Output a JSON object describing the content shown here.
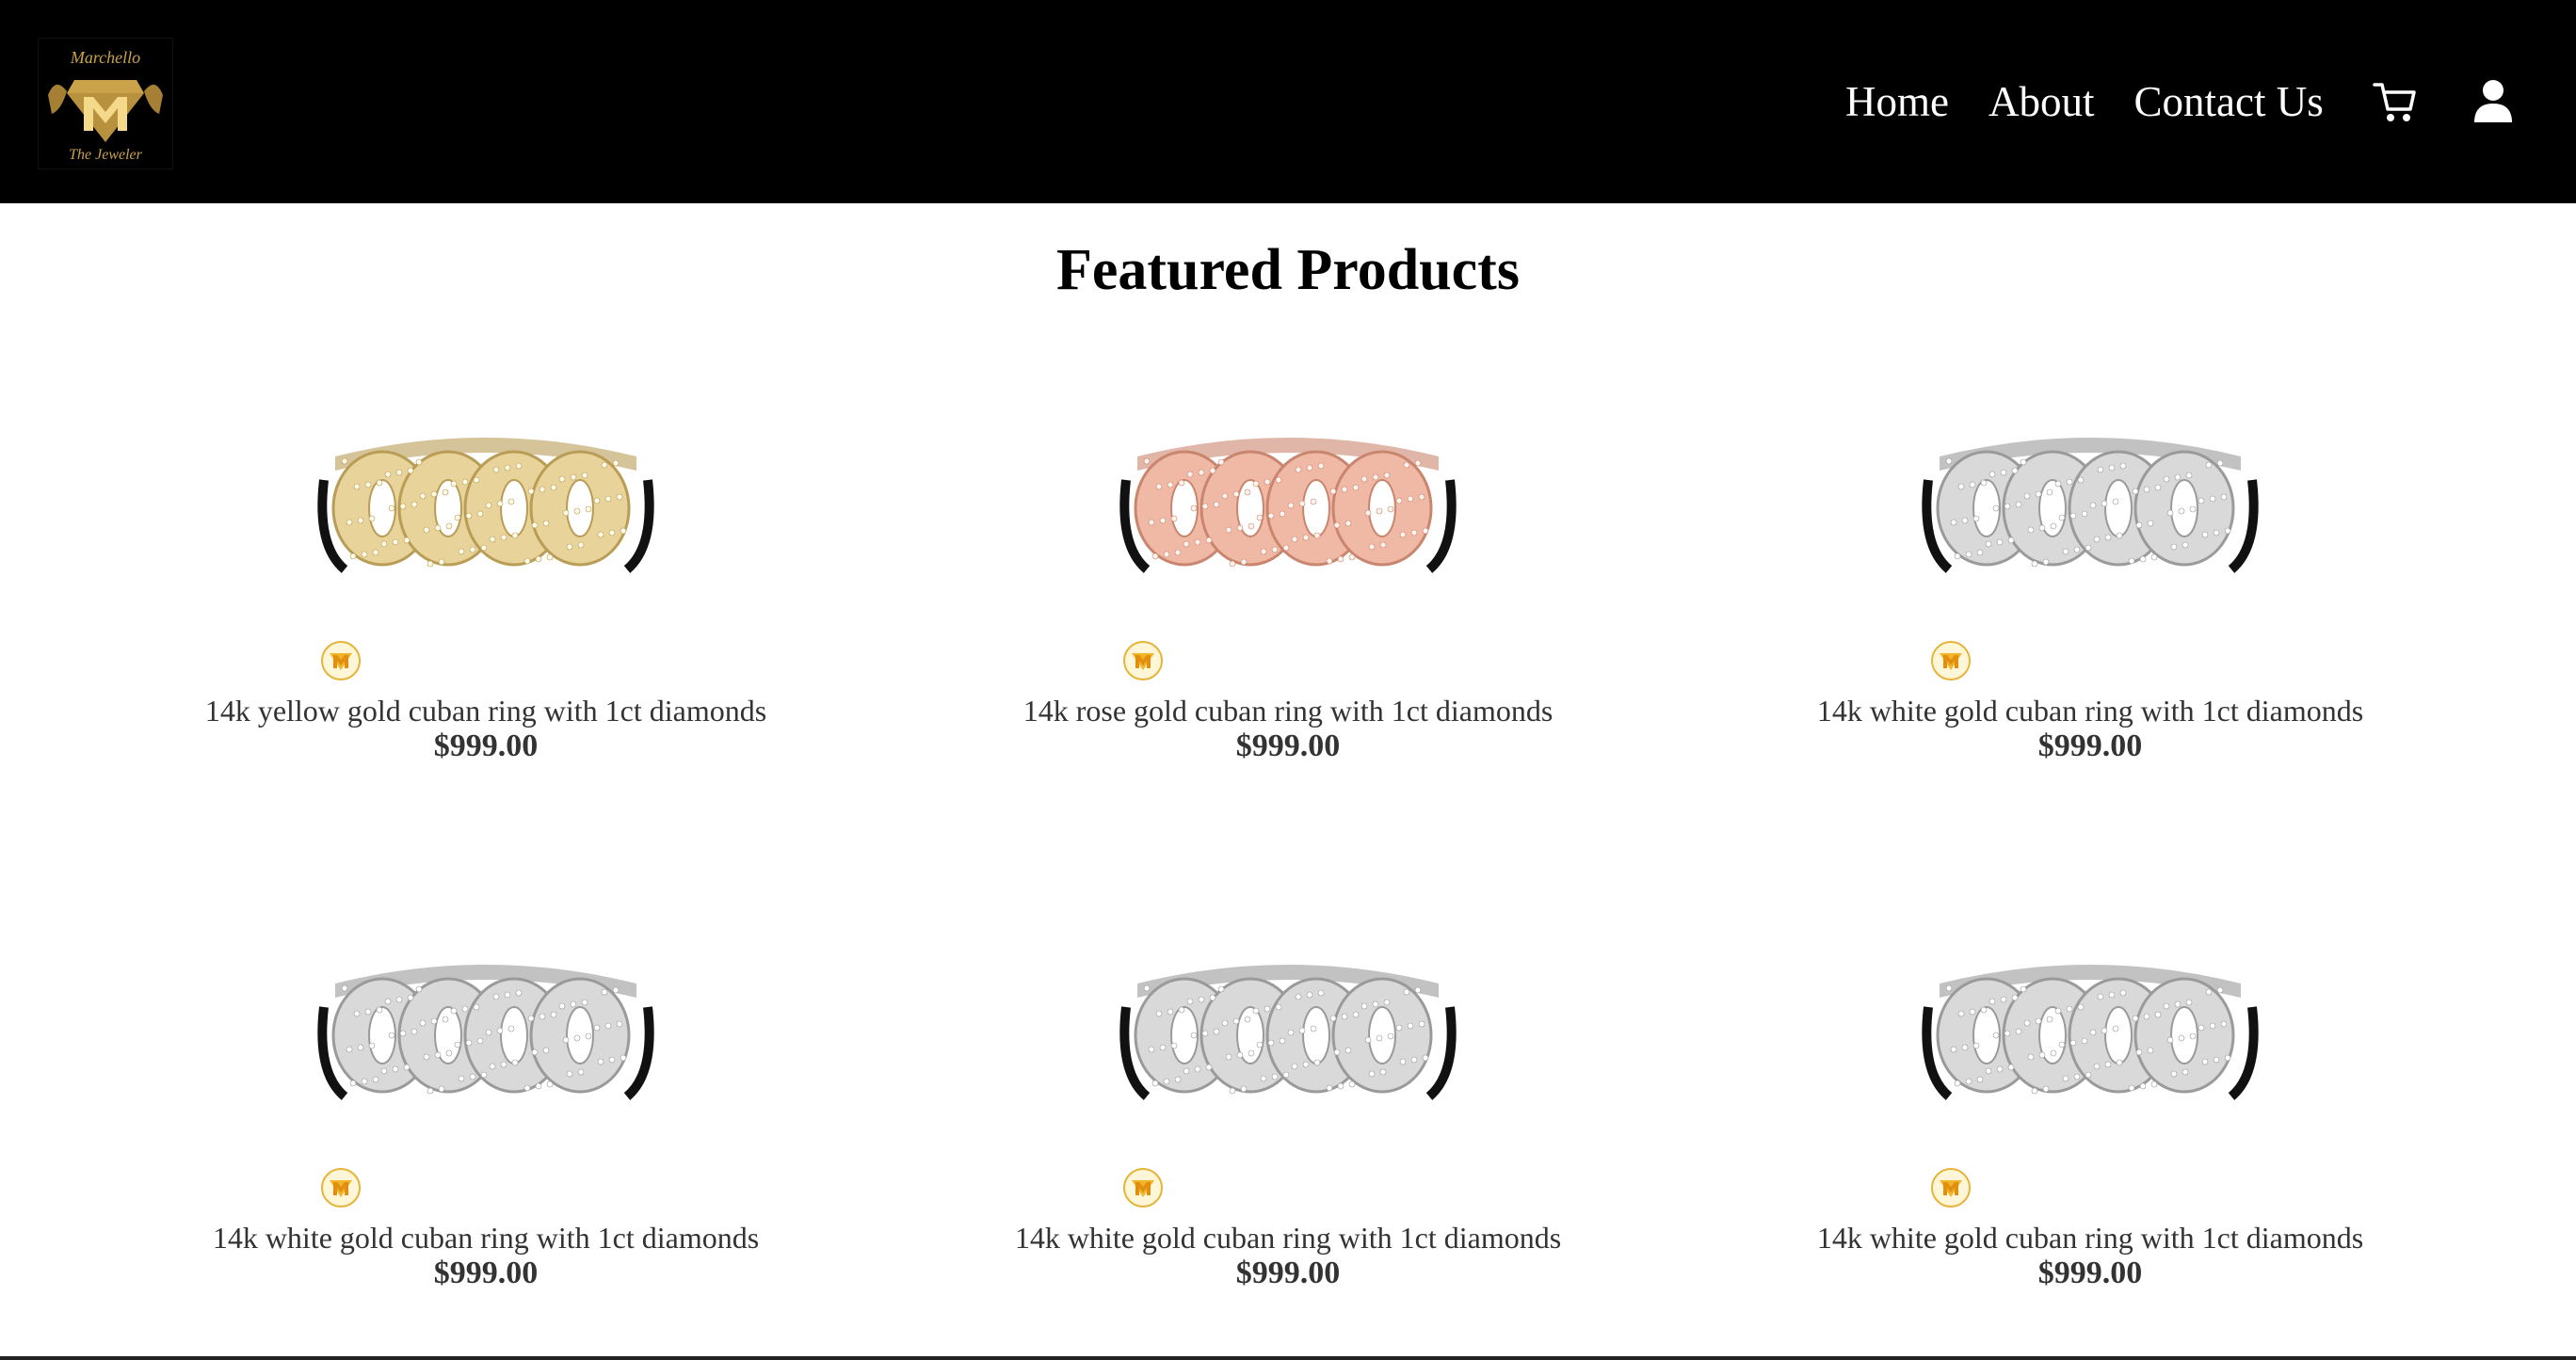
{
  "header": {
    "logo_alt": "Marchello The Jeweler",
    "nav": [
      {
        "label": "Home"
      },
      {
        "label": "About"
      },
      {
        "label": "Contact Us"
      }
    ],
    "cart_icon": "cart-icon",
    "account_icon": "user-icon"
  },
  "main": {
    "title": "Featured Products",
    "products": [
      {
        "name": "14k yellow gold cuban ring with 1ct diamonds",
        "price": "$999.00",
        "metal": "yellow"
      },
      {
        "name": "14k rose gold cuban ring with 1ct diamonds",
        "price": "$999.00",
        "metal": "rose"
      },
      {
        "name": "14k white gold cuban ring with 1ct diamonds",
        "price": "$999.00",
        "metal": "white"
      },
      {
        "name": "14k white gold cuban ring with 1ct diamonds",
        "price": "$999.00",
        "metal": "white"
      },
      {
        "name": "14k white gold cuban ring with 1ct diamonds",
        "price": "$999.00",
        "metal": "white"
      },
      {
        "name": "14k white gold cuban ring with 1ct diamonds",
        "price": "$999.00",
        "metal": "white"
      }
    ]
  },
  "colors": {
    "header_bg": "#000000",
    "nav_text": "#ffffff",
    "gold": "#c9a24a",
    "yellow_metal": "#e8d39a",
    "rose_metal": "#f0b9a5",
    "white_metal": "#d9d9d9"
  }
}
